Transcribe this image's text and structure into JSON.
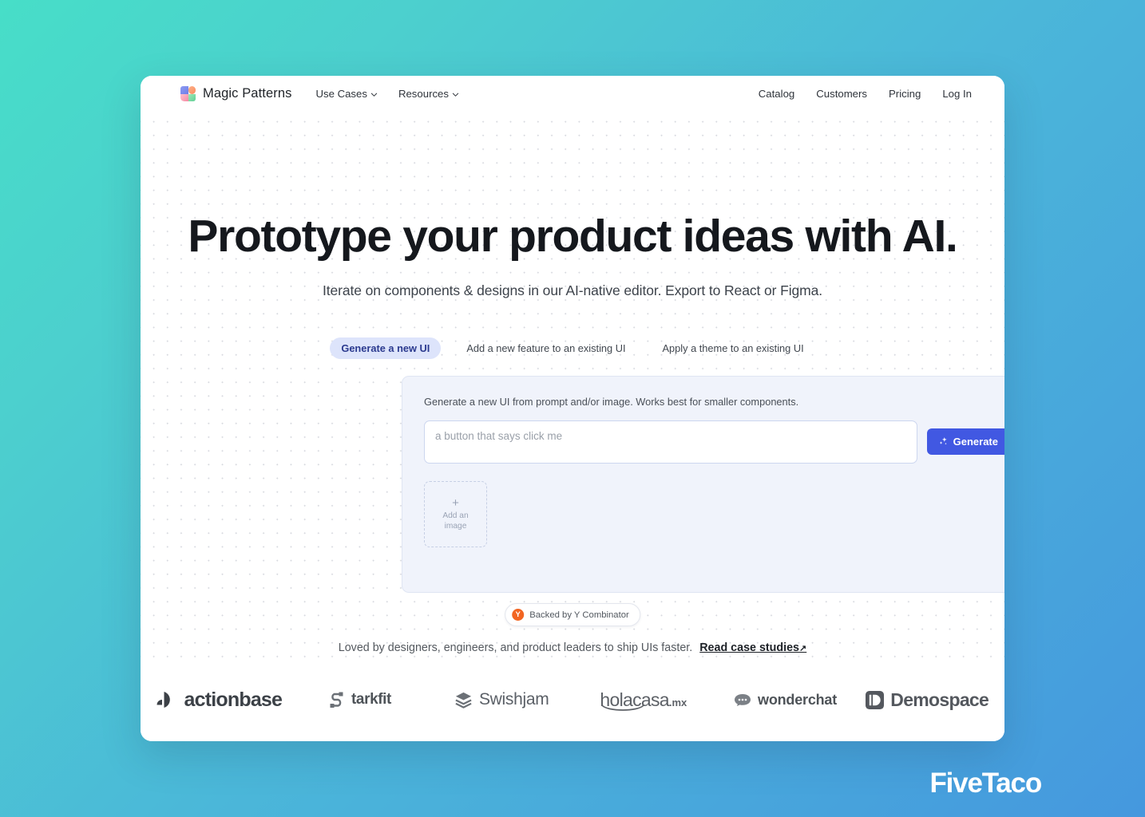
{
  "brand": {
    "name": "Magic Patterns",
    "logo_icon": "magic-patterns-logo-icon"
  },
  "nav": {
    "left_items": [
      {
        "label": "Use Cases",
        "has_dropdown": true
      },
      {
        "label": "Resources",
        "has_dropdown": true
      }
    ],
    "right_items": [
      {
        "label": "Catalog"
      },
      {
        "label": "Customers"
      },
      {
        "label": "Pricing"
      },
      {
        "label": "Log In"
      }
    ]
  },
  "hero": {
    "headline": "Prototype your product ideas with AI.",
    "subhead": "Iterate on components & designs in our AI-native editor. Export to React or Figma."
  },
  "tabs": [
    {
      "label": "Generate a new UI",
      "active": true
    },
    {
      "label": "Add a new feature to an existing UI",
      "active": false
    },
    {
      "label": "Apply a theme to an existing UI",
      "active": false
    }
  ],
  "panel": {
    "description": "Generate a new UI from prompt and/or image. Works best for smaller components.",
    "prompt_placeholder": "a button that says click me",
    "prompt_value": "",
    "generate_label": "Generate",
    "generate_icon": "sparkle-icon",
    "upload": {
      "plus": "+",
      "label": "Add an image",
      "icon": "plus-icon"
    }
  },
  "yc_badge": {
    "mark": "Y",
    "text": "Backed by Y Combinator"
  },
  "social_proof": {
    "text": "Loved by designers, engineers, and product leaders to ship UIs faster.",
    "link_label": "Read case studies",
    "link_arrow": "↗"
  },
  "logos": [
    {
      "name": "actionbase",
      "icon": "actionbase-mark-icon"
    },
    {
      "name": "tarkfit",
      "display": "tarkfit",
      "icon": "starkfit-s-icon"
    },
    {
      "name": "Swishjam",
      "icon": "swishjam-layers-icon"
    },
    {
      "name": "holacasa",
      "suffix": ".mx",
      "icon": "holacasa-smile-icon"
    },
    {
      "name": "wonderchat",
      "icon": "wonderchat-bubble-icon"
    },
    {
      "name": "Demospace",
      "icon": "demospace-d-icon"
    }
  ],
  "chat_widget": {
    "icon": "chat-bubble-icon"
  },
  "watermark": {
    "text": "FiveTaco"
  },
  "colors": {
    "accent_blue": "#4158e2",
    "tab_active_bg": "#dde4fb",
    "tab_active_text": "#2b3a8f",
    "panel_bg": "#f0f3fb",
    "yc_orange": "#f26522",
    "chat_blue": "#2f76ee",
    "bg_gradient_start": "#47dec8",
    "bg_gradient_end": "#4598de"
  }
}
